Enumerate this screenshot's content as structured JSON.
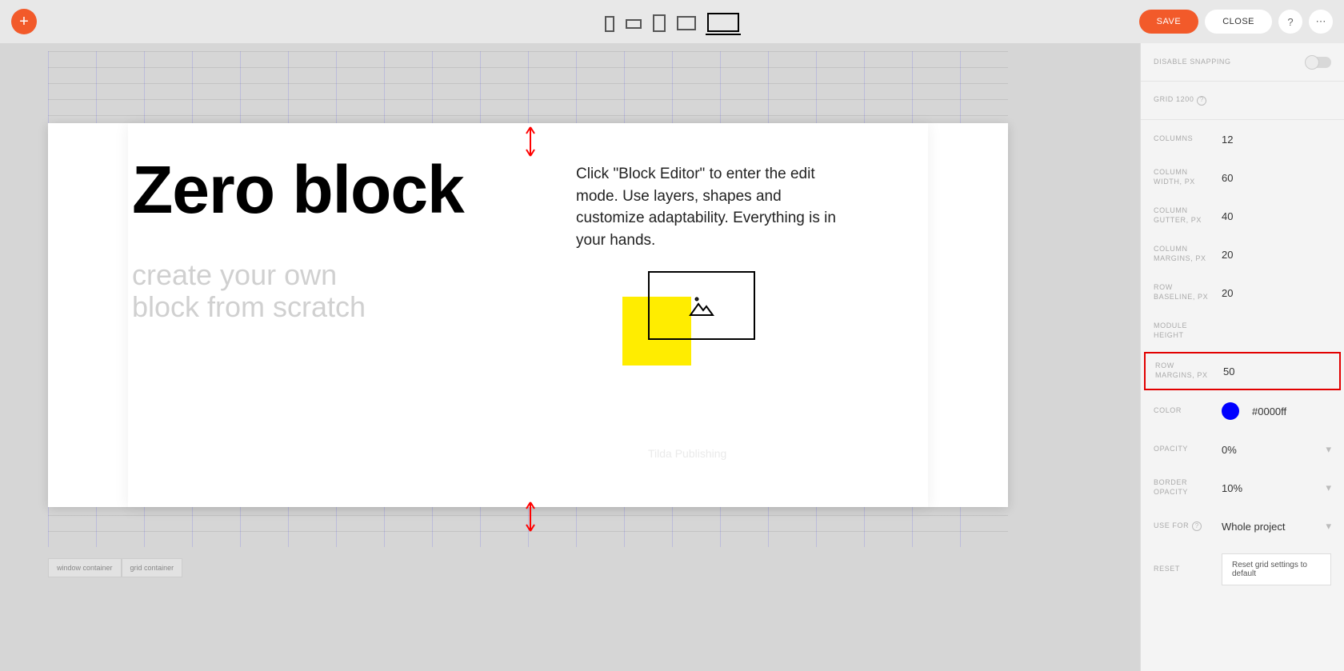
{
  "toolbar": {
    "save": "SAVE",
    "close": "CLOSE"
  },
  "canvas": {
    "title": "Zero block",
    "subtitle_l1": "create your own",
    "subtitle_l2": "block from scratch",
    "description": "Click \"Block Editor\" to enter the edit mode. Use layers, shapes and customize adaptability. Everything is in your hands.",
    "watermark": "Tilda Publishing",
    "tabs": {
      "window": "window container",
      "grid": "grid container"
    }
  },
  "panel": {
    "disable_snapping": "DISABLE SNAPPING",
    "grid_label": "GRID 1200",
    "columns": {
      "label": "COLUMNS",
      "value": "12"
    },
    "column_width": {
      "label": "COLUMN WIDTH, PX",
      "value": "60"
    },
    "column_gutter": {
      "label": "COLUMN GUTTER, PX",
      "value": "40"
    },
    "column_margins": {
      "label": "COLUMN MARGINS, PX",
      "value": "20"
    },
    "row_baseline": {
      "label": "ROW BASELINE, PX",
      "value": "20"
    },
    "module_height": {
      "label": "MODULE HEIGHT",
      "value": ""
    },
    "row_margins": {
      "label": "ROW MARGINS, PX",
      "value": "50"
    },
    "color": {
      "label": "COLOR",
      "value": "#0000ff"
    },
    "opacity": {
      "label": "OPACITY",
      "value": "0%"
    },
    "border_opacity": {
      "label": "BORDER OPACITY",
      "value": "10%"
    },
    "use_for": {
      "label": "USE FOR",
      "value": "Whole project"
    },
    "reset": {
      "label": "RESET",
      "button": "Reset grid settings to default"
    }
  }
}
